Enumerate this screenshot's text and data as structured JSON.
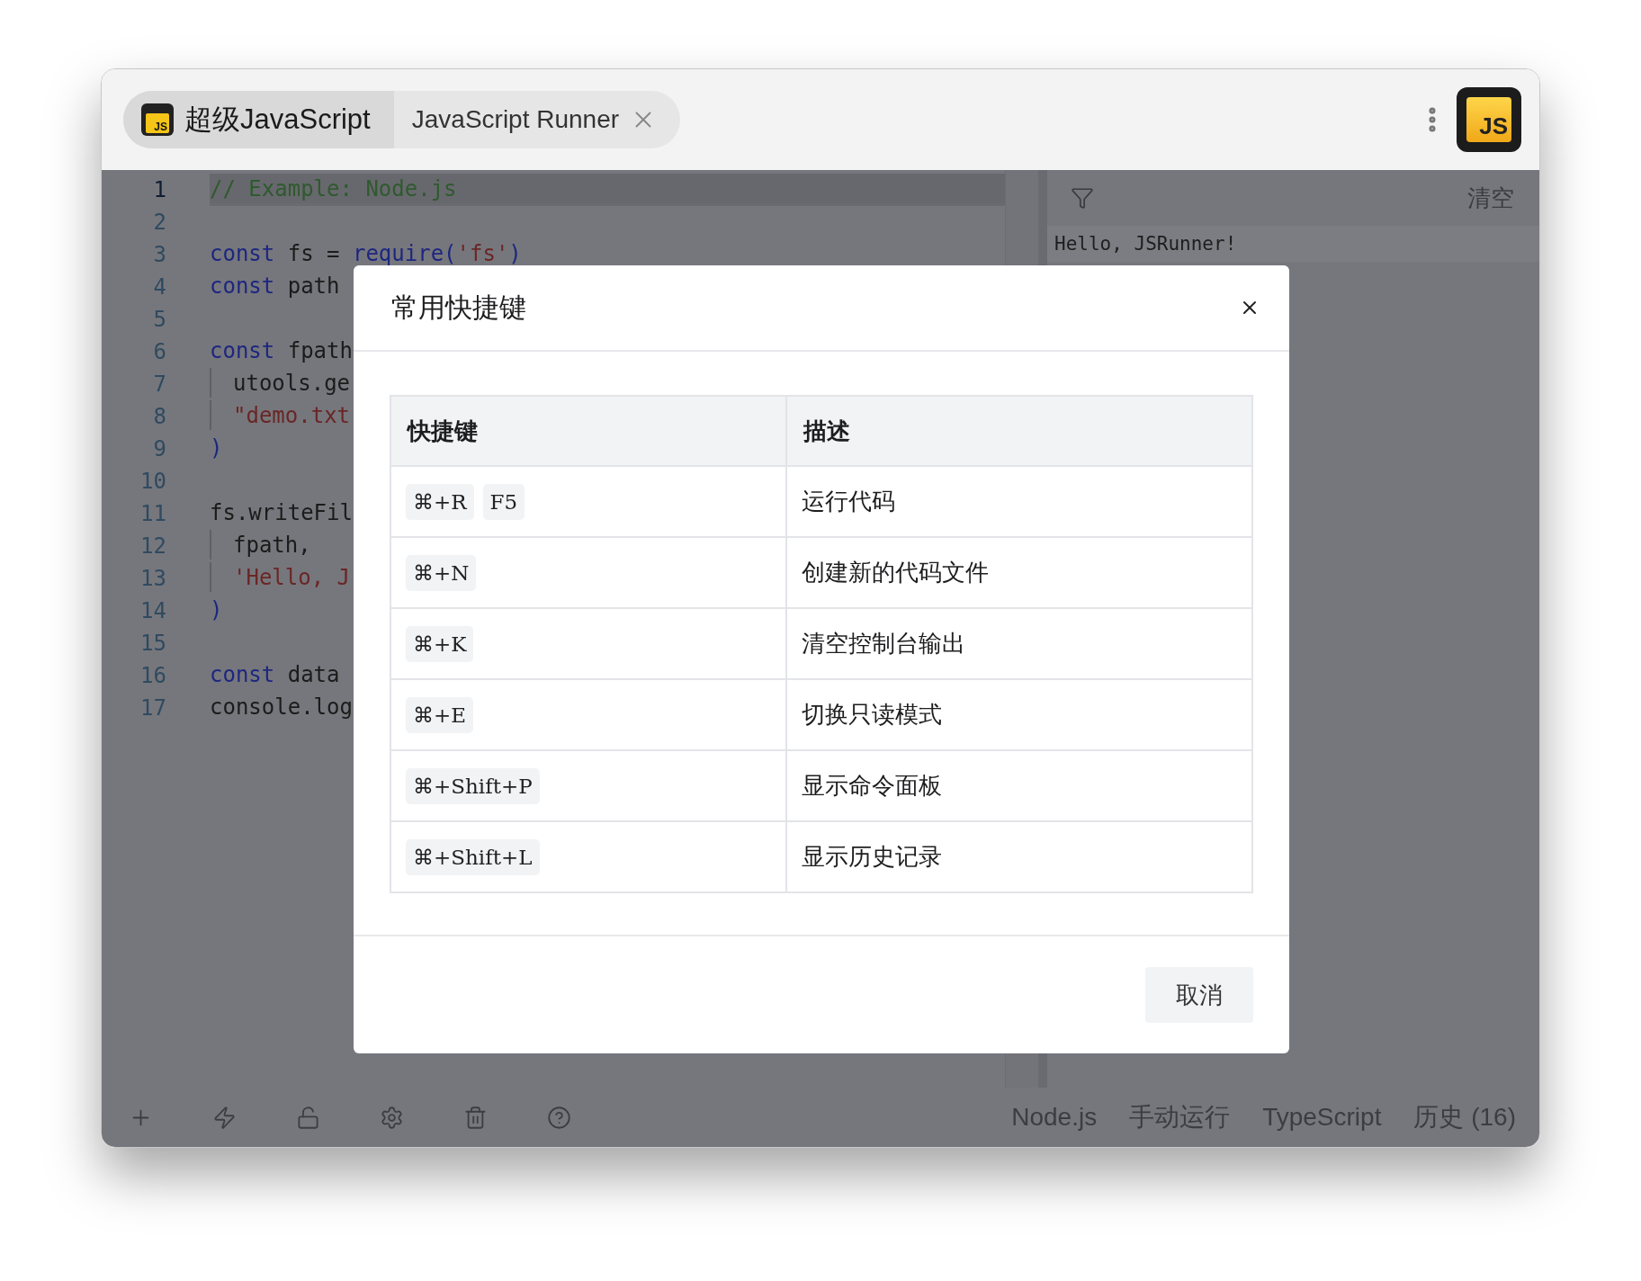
{
  "tabs": [
    {
      "label": "超级JavaScript",
      "icon_text": "JS",
      "selected": true,
      "closable": false
    },
    {
      "label": "JavaScript Runner",
      "selected": false,
      "closable": true
    }
  ],
  "app_logo": {
    "text": "JS"
  },
  "editor": {
    "lines": [
      {
        "number": "1",
        "active": true,
        "indented": false,
        "tokens": [
          {
            "kind": "comment",
            "text": "// Example: Node.js"
          }
        ]
      },
      {
        "number": "2",
        "active": false,
        "indented": false
      },
      {
        "number": "3",
        "active": false,
        "indented": false,
        "tokens": [
          {
            "kind": "keyword",
            "text": "const"
          },
          {
            "kind": "plain",
            "text": " fs = "
          },
          {
            "kind": "func",
            "text": "require"
          },
          {
            "kind": "func",
            "text": "("
          },
          {
            "kind": "string",
            "text": "'fs'"
          },
          {
            "kind": "func",
            "text": ")"
          }
        ]
      },
      {
        "number": "4",
        "active": false,
        "indented": false,
        "tokens": [
          {
            "kind": "keyword",
            "text": "const"
          },
          {
            "kind": "plain",
            "text": " path"
          }
        ]
      },
      {
        "number": "5",
        "active": false,
        "indented": false
      },
      {
        "number": "6",
        "active": false,
        "indented": false,
        "tokens": [
          {
            "kind": "keyword",
            "text": "const"
          },
          {
            "kind": "plain",
            "text": " fpath"
          }
        ]
      },
      {
        "number": "7",
        "active": false,
        "indented": true,
        "tokens": [
          {
            "kind": "plain",
            "text": "utools.ge"
          }
        ]
      },
      {
        "number": "8",
        "active": false,
        "indented": true,
        "tokens": [
          {
            "kind": "string",
            "text": "\"demo.txt"
          }
        ]
      },
      {
        "number": "9",
        "active": false,
        "indented": false,
        "tokens": [
          {
            "kind": "func",
            "text": ")"
          }
        ]
      },
      {
        "number": "10",
        "active": false,
        "indented": false
      },
      {
        "number": "11",
        "active": false,
        "indented": false,
        "tokens": [
          {
            "kind": "plain",
            "text": "fs.writeFil"
          }
        ]
      },
      {
        "number": "12",
        "active": false,
        "indented": true,
        "tokens": [
          {
            "kind": "plain",
            "text": "fpath,"
          }
        ]
      },
      {
        "number": "13",
        "active": false,
        "indented": true,
        "tokens": [
          {
            "kind": "string",
            "text": "'Hello, J"
          }
        ]
      },
      {
        "number": "14",
        "active": false,
        "indented": false,
        "tokens": [
          {
            "kind": "func",
            "text": ")"
          }
        ]
      },
      {
        "number": "15",
        "active": false,
        "indented": false
      },
      {
        "number": "16",
        "active": false,
        "indented": false,
        "tokens": [
          {
            "kind": "keyword",
            "text": "const"
          },
          {
            "kind": "plain",
            "text": " data"
          }
        ]
      },
      {
        "number": "17",
        "active": false,
        "indented": false,
        "tokens": [
          {
            "kind": "plain",
            "text": "console.log"
          }
        ]
      }
    ]
  },
  "console": {
    "clear_button": "清空",
    "output": [
      "Hello, JSRunner!"
    ]
  },
  "toolbar": {
    "items": [
      "Node.js",
      "手动运行",
      "TypeScript",
      "历史 (16)"
    ]
  },
  "dialog": {
    "title": "常用快捷键",
    "columns": [
      "快捷键",
      "描述"
    ],
    "rows": [
      {
        "keys": [
          "⌘+R",
          "F5"
        ],
        "description": "运行代码"
      },
      {
        "keys": [
          "⌘+N"
        ],
        "description": "创建新的代码文件"
      },
      {
        "keys": [
          "⌘+K"
        ],
        "description": "清空控制台输出"
      },
      {
        "keys": [
          "⌘+E"
        ],
        "description": "切换只读模式"
      },
      {
        "keys": [
          "⌘+Shift+P"
        ],
        "description": "显示命令面板"
      },
      {
        "keys": [
          "⌘+Shift+L"
        ],
        "description": "显示历史记录"
      }
    ],
    "cancel_button": "取消"
  }
}
